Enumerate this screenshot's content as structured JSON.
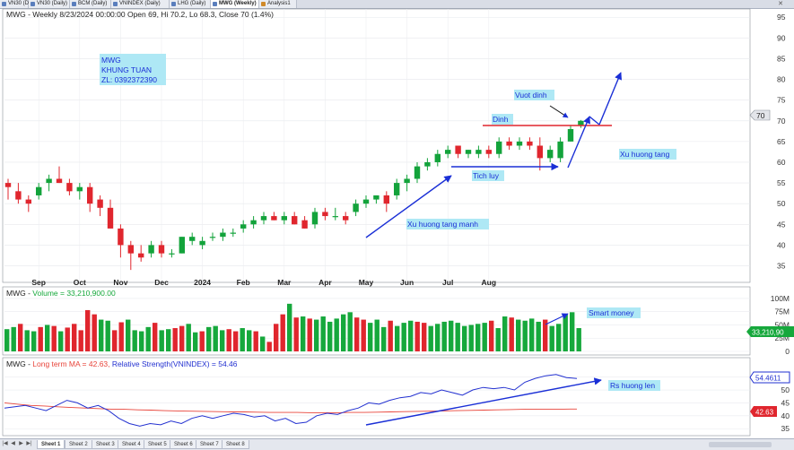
{
  "tabs": [
    {
      "label": "VN30 (Daily)",
      "active": false
    },
    {
      "label": "VN30 (Daily)",
      "active": false
    },
    {
      "label": "BCM (Daily)",
      "active": false
    },
    {
      "label": "VNINDEX (Daily)",
      "active": false
    },
    {
      "label": "LHG (Daily)",
      "active": false
    },
    {
      "label": "MWG (Weekly)",
      "active": true
    },
    {
      "label": "Analysis1",
      "active": false
    }
  ],
  "tab_close": "✕",
  "sheets": [
    "Sheet 1",
    "Sheet 2",
    "Sheet 3",
    "Sheet 4",
    "Sheet 5",
    "Sheet 6",
    "Sheet 7",
    "Sheet 8"
  ],
  "sheet_nav": [
    "|◀",
    "◀",
    "▶",
    "▶|"
  ],
  "colors": {
    "up": "#13a33b",
    "down": "#e0262e",
    "trend": "#1a2fd6",
    "highlight": "#aeeafa",
    "label_bg": "#aee8f5",
    "ma": "#e8443a",
    "rs": "#2230d0",
    "volume_up": "#16a83c"
  },
  "chart_data": [
    {
      "type": "candlestick",
      "title": "MWG - Weekly 8/23/2024 00:00:00 Open 69, Hi 70.2, Lo 68.3, Close 70 (1.4%)",
      "ylim": [
        31,
        97
      ],
      "yticks": [
        35,
        40,
        45,
        50,
        55,
        60,
        65,
        70,
        75,
        80,
        85,
        90,
        95
      ],
      "last_price_label": "70",
      "x_labels": [
        {
          "i": 3,
          "label": "Sep"
        },
        {
          "i": 7,
          "label": "Oct"
        },
        {
          "i": 11,
          "label": "Nov"
        },
        {
          "i": 15,
          "label": "Dec"
        },
        {
          "i": 19,
          "label": "2024"
        },
        {
          "i": 23,
          "label": "Feb"
        },
        {
          "i": 27,
          "label": "Mar"
        },
        {
          "i": 31,
          "label": "Apr"
        },
        {
          "i": 35,
          "label": "May"
        },
        {
          "i": 39,
          "label": "Jun"
        },
        {
          "i": 43,
          "label": "Jul"
        },
        {
          "i": 47,
          "label": "Aug"
        }
      ],
      "candles": [
        {
          "o": 55,
          "h": 56,
          "l": 51,
          "c": 54
        },
        {
          "o": 53,
          "h": 55,
          "l": 50,
          "c": 51
        },
        {
          "o": 51,
          "h": 52,
          "l": 48,
          "c": 50
        },
        {
          "o": 52,
          "h": 55,
          "l": 51,
          "c": 54
        },
        {
          "o": 55,
          "h": 57,
          "l": 53,
          "c": 56
        },
        {
          "o": 56,
          "h": 59,
          "l": 55,
          "c": 55
        },
        {
          "o": 55,
          "h": 56,
          "l": 52,
          "c": 53
        },
        {
          "o": 53,
          "h": 55,
          "l": 51,
          "c": 54
        },
        {
          "o": 54,
          "h": 55,
          "l": 48,
          "c": 50
        },
        {
          "o": 51,
          "h": 52,
          "l": 47,
          "c": 49
        },
        {
          "o": 49,
          "h": 51,
          "l": 44,
          "c": 44
        },
        {
          "o": 44,
          "h": 45,
          "l": 37,
          "c": 40
        },
        {
          "o": 40,
          "h": 41,
          "l": 34,
          "c": 38
        },
        {
          "o": 38,
          "h": 40,
          "l": 36,
          "c": 37
        },
        {
          "o": 38,
          "h": 41,
          "l": 37,
          "c": 40
        },
        {
          "o": 40,
          "h": 41,
          "l": 37,
          "c": 38
        },
        {
          "o": 38,
          "h": 39,
          "l": 37,
          "c": 38
        },
        {
          "o": 38,
          "h": 42,
          "l": 38,
          "c": 42
        },
        {
          "o": 41,
          "h": 43,
          "l": 40,
          "c": 42
        },
        {
          "o": 40,
          "h": 42,
          "l": 39,
          "c": 41
        },
        {
          "o": 42,
          "h": 43,
          "l": 41,
          "c": 42
        },
        {
          "o": 42,
          "h": 44,
          "l": 41,
          "c": 43
        },
        {
          "o": 43,
          "h": 44,
          "l": 42,
          "c": 43
        },
        {
          "o": 44,
          "h": 46,
          "l": 43,
          "c": 45
        },
        {
          "o": 45,
          "h": 47,
          "l": 44,
          "c": 46
        },
        {
          "o": 46,
          "h": 48,
          "l": 45,
          "c": 47
        },
        {
          "o": 47,
          "h": 48,
          "l": 46,
          "c": 46
        },
        {
          "o": 46,
          "h": 48,
          "l": 45,
          "c": 47
        },
        {
          "o": 47,
          "h": 48,
          "l": 45,
          "c": 45
        },
        {
          "o": 46,
          "h": 47,
          "l": 44,
          "c": 44
        },
        {
          "o": 45,
          "h": 49,
          "l": 44,
          "c": 48
        },
        {
          "o": 48,
          "h": 49,
          "l": 46,
          "c": 47
        },
        {
          "o": 47,
          "h": 49,
          "l": 46,
          "c": 47
        },
        {
          "o": 47,
          "h": 48,
          "l": 45,
          "c": 46
        },
        {
          "o": 48,
          "h": 51,
          "l": 47,
          "c": 50
        },
        {
          "o": 50,
          "h": 52,
          "l": 49,
          "c": 51
        },
        {
          "o": 51,
          "h": 52,
          "l": 50,
          "c": 52
        },
        {
          "o": 52,
          "h": 53,
          "l": 48,
          "c": 50
        },
        {
          "o": 52,
          "h": 56,
          "l": 51,
          "c": 55
        },
        {
          "o": 55,
          "h": 57,
          "l": 53,
          "c": 56
        },
        {
          "o": 56,
          "h": 60,
          "l": 55,
          "c": 59
        },
        {
          "o": 59,
          "h": 61,
          "l": 58,
          "c": 60
        },
        {
          "o": 60,
          "h": 63,
          "l": 59,
          "c": 62
        },
        {
          "o": 62,
          "h": 64,
          "l": 61,
          "c": 63
        },
        {
          "o": 64,
          "h": 64,
          "l": 61,
          "c": 62
        },
        {
          "o": 62,
          "h": 63,
          "l": 61,
          "c": 63
        },
        {
          "o": 62,
          "h": 64,
          "l": 61,
          "c": 63
        },
        {
          "o": 63,
          "h": 64,
          "l": 61,
          "c": 62
        },
        {
          "o": 62,
          "h": 66,
          "l": 61,
          "c": 65
        },
        {
          "o": 65,
          "h": 66,
          "l": 63,
          "c": 64
        },
        {
          "o": 64,
          "h": 66,
          "l": 63,
          "c": 65
        },
        {
          "o": 65,
          "h": 66,
          "l": 63,
          "c": 64
        },
        {
          "o": 64,
          "h": 66,
          "l": 58,
          "c": 61
        },
        {
          "o": 61,
          "h": 64,
          "l": 60,
          "c": 63
        },
        {
          "o": 61,
          "h": 66,
          "l": 60,
          "c": 65
        },
        {
          "o": 65,
          "h": 69,
          "l": 65,
          "c": 68
        },
        {
          "o": 69,
          "h": 70.2,
          "l": 68.3,
          "c": 70
        }
      ],
      "annotations": [
        {
          "text": "MWG"
        },
        {
          "text": "KHUNG TUAN"
        },
        {
          "text": "ZL: 0392372390"
        },
        {
          "text": "Vuot dinh"
        },
        {
          "text": "Dinh"
        },
        {
          "text": "Tich luy"
        },
        {
          "text": "Xu huong tang"
        },
        {
          "text": "Xu huong tang manh"
        }
      ]
    },
    {
      "type": "bar",
      "title_name": "MWG - ",
      "title_value": "Volume = 33,210,900.00",
      "ylim": [
        0,
        105
      ],
      "yticks": [
        {
          "v": 0,
          "label": "0"
        },
        {
          "v": 25,
          "label": "25M"
        },
        {
          "v": 50,
          "label": "50M"
        },
        {
          "v": 75,
          "label": "75M"
        },
        {
          "v": 100,
          "label": "100M"
        }
      ],
      "last_value_label": "33,210,90",
      "annotation": "Smart money",
      "values": [
        42,
        46,
        52,
        40,
        38,
        46,
        50,
        48,
        38,
        45,
        52,
        40,
        78,
        70,
        60,
        58,
        40,
        55,
        60,
        40,
        38,
        46,
        54,
        40,
        42,
        44,
        48,
        52,
        36,
        38,
        46,
        48,
        40,
        42,
        38,
        44,
        40,
        38,
        28,
        18,
        52,
        70,
        90,
        64,
        66,
        62,
        60,
        66,
        56,
        62,
        70,
        74,
        64,
        60,
        54,
        60,
        46,
        58,
        48,
        54,
        58,
        56,
        54,
        48,
        52,
        56,
        58,
        54,
        48,
        50,
        52,
        54,
        58,
        44,
        66,
        64,
        60,
        58,
        62,
        56,
        60,
        48,
        52,
        70,
        74,
        44
      ],
      "up": [
        true,
        true,
        false,
        true,
        true,
        false,
        true,
        false,
        true,
        false,
        false,
        false,
        false,
        false,
        true,
        true,
        false,
        false,
        true,
        true,
        true,
        true,
        false,
        true,
        true,
        false,
        false,
        true,
        true,
        false,
        true,
        true,
        true,
        false,
        false,
        true,
        true,
        false,
        true,
        false,
        false,
        false,
        true,
        false,
        true,
        false,
        true,
        true,
        true,
        true,
        true,
        true,
        false,
        false,
        true,
        true,
        true,
        false,
        true,
        true,
        true,
        false,
        false,
        true,
        true,
        true,
        true,
        true,
        true,
        true,
        true,
        true,
        false,
        true,
        true,
        false,
        true,
        true,
        true,
        true,
        false,
        true,
        true,
        true,
        true,
        true
      ]
    },
    {
      "type": "line",
      "title_a": "MWG - ",
      "title_b": "Long term MA = 42.63, ",
      "title_c": "Relative Strength(VNINDEX) = 54.46",
      "ylim": [
        33,
        58
      ],
      "yticks": [
        35,
        40,
        45,
        50,
        55
      ],
      "annotation": "Rs huong len",
      "series": [
        {
          "name": "Long term MA",
          "label": "42.63",
          "values": [
            45,
            44.5,
            44,
            43.8,
            43.5,
            43.2,
            43,
            42.8,
            42.6,
            42.5,
            42.3,
            42.2,
            42,
            41.9,
            41.8,
            41.7,
            41.6,
            41.5,
            41.5,
            41.4,
            41.3,
            41.3,
            41.3,
            41.2,
            41.2,
            41.2,
            41.3,
            41.3,
            41.4,
            41.5,
            41.6,
            41.7,
            41.8,
            41.9,
            42,
            42.1,
            42.2,
            42.3,
            42.4,
            42.5,
            42.6,
            42.6,
            42.6,
            42.63
          ]
        },
        {
          "name": "Relative Strength(VNINDEX)",
          "label": "54.4611",
          "values": [
            43,
            43.5,
            44,
            43,
            42,
            44,
            46,
            45,
            43,
            44,
            42,
            39,
            37,
            36,
            37,
            36.5,
            38,
            37,
            39,
            40,
            39,
            40,
            41,
            40.5,
            39.5,
            40,
            38,
            39,
            37,
            37.5,
            40,
            41,
            40.5,
            42,
            43,
            45,
            44.5,
            46,
            47,
            47.5,
            49,
            48.5,
            50,
            49,
            48,
            50,
            51,
            50.5,
            51,
            50,
            53,
            54.5,
            55.5,
            56,
            54.8,
            54.46
          ]
        }
      ]
    }
  ]
}
